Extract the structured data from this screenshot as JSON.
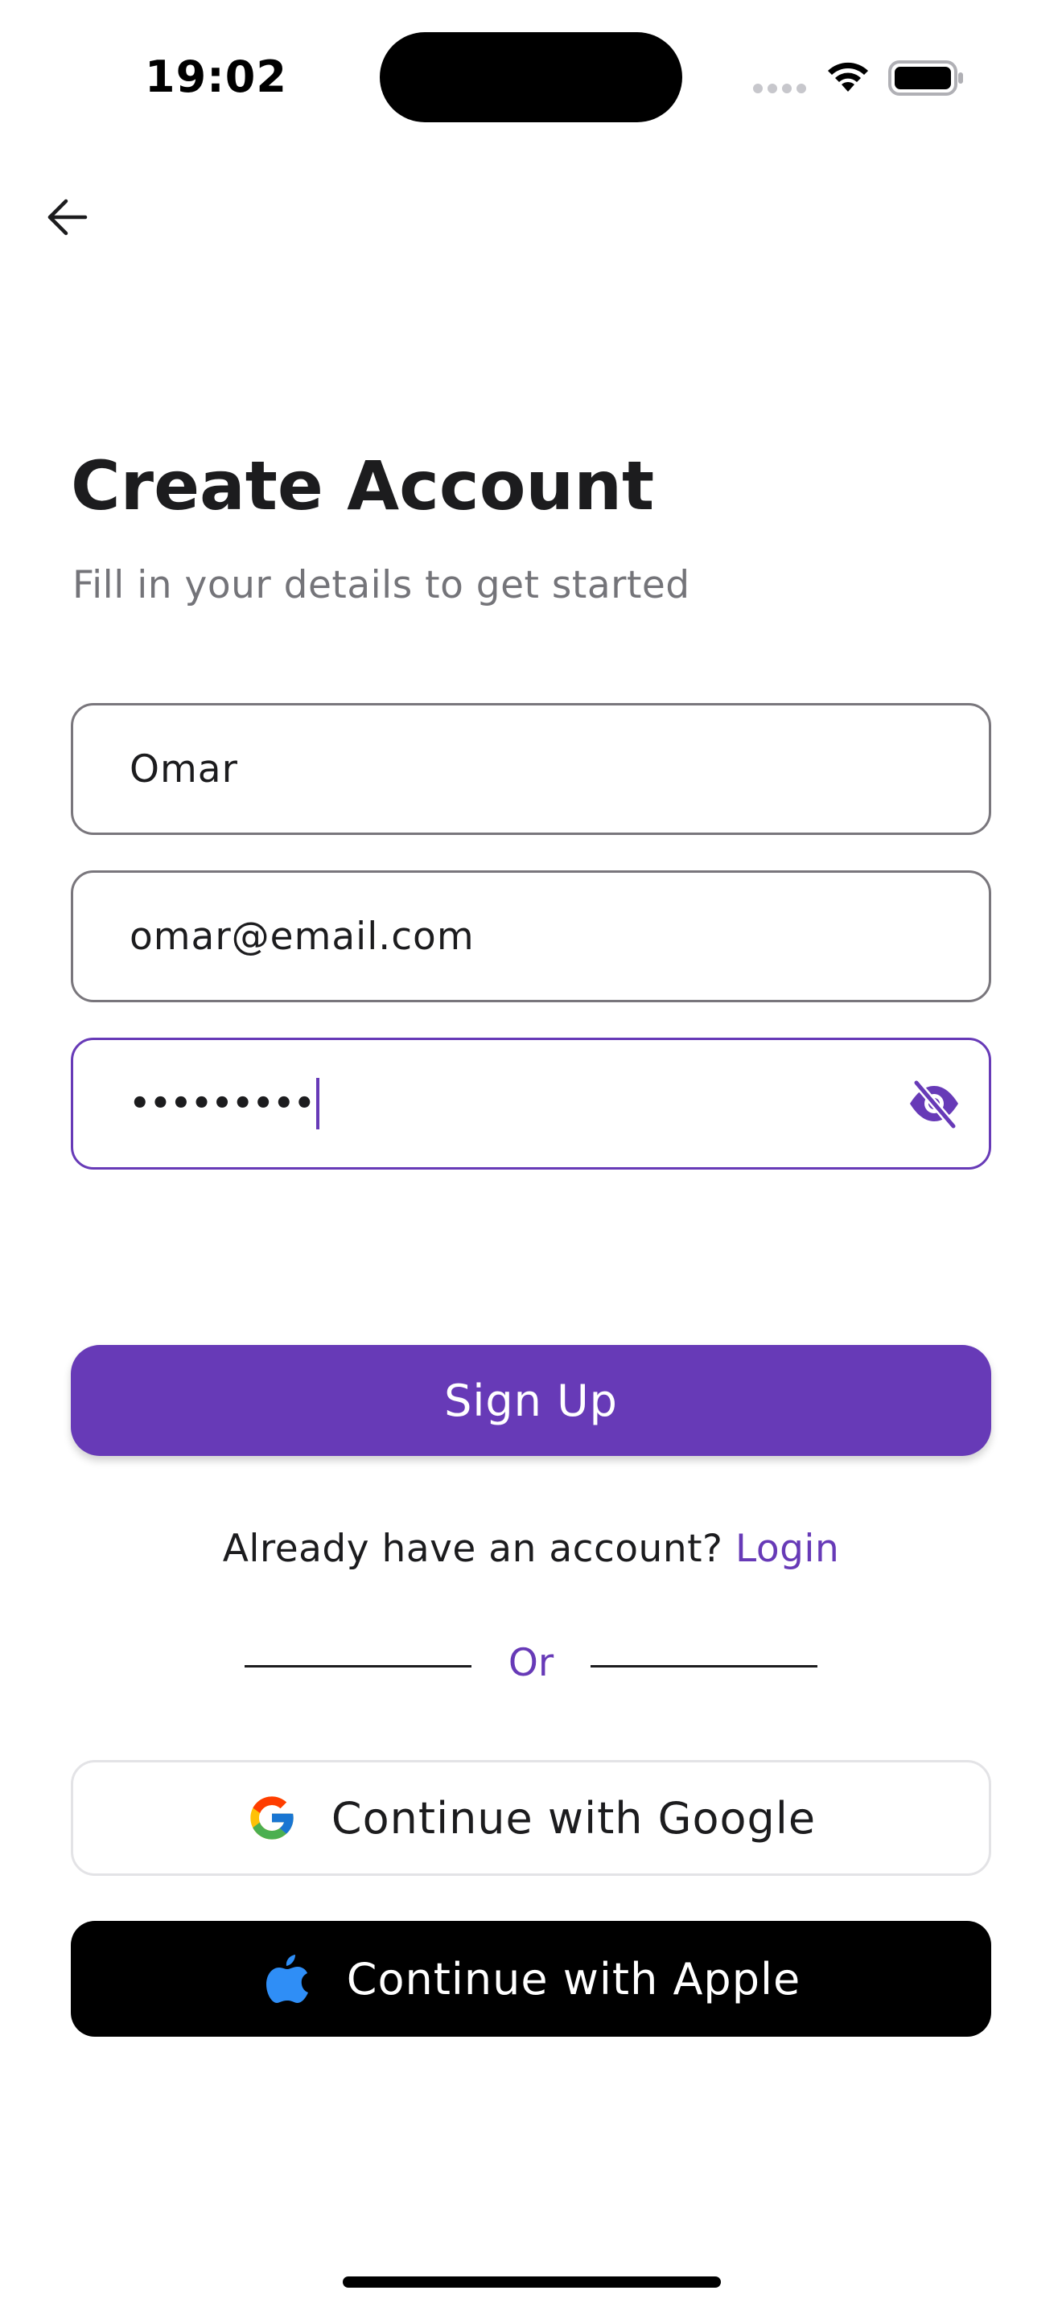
{
  "status_bar": {
    "time": "19:02",
    "icons": [
      "signal-icon",
      "wifi-icon",
      "battery-icon"
    ]
  },
  "nav": {
    "back_icon": "arrow-left-icon"
  },
  "header": {
    "title": "Create Account",
    "subtitle": "Fill in your details to get started"
  },
  "form": {
    "name_value": "Omar",
    "email_value": "omar@email.com",
    "password_masked": "•••••••••",
    "password_toggle_icon": "eye-off-icon"
  },
  "actions": {
    "signup_label": "Sign Up",
    "login_prompt": "Already have an account?",
    "login_link": "Login",
    "divider_label": "Or",
    "google_label": "Continue with Google",
    "google_icon": "google-icon",
    "apple_label": "Continue with Apple",
    "apple_icon": "apple-icon"
  },
  "colors": {
    "accent": "#673ab7",
    "text": "#1c1c1e",
    "muted": "#747479",
    "apple_button": "#000000",
    "apple_logo": "#2f8ef6"
  }
}
